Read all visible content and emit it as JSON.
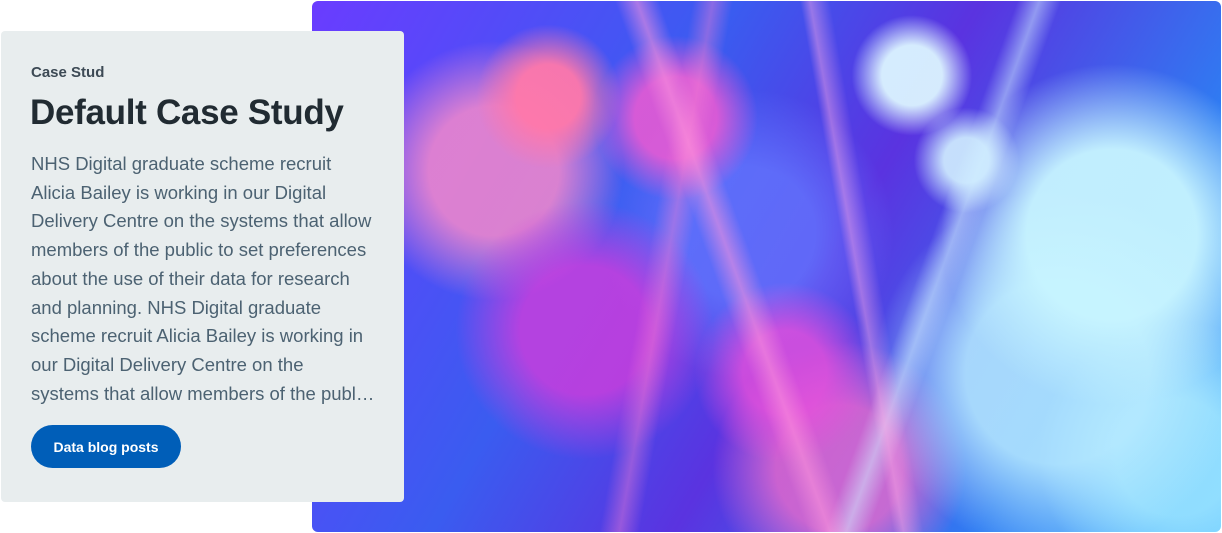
{
  "card": {
    "eyebrow": "Case Stud",
    "title": "Default Case Study",
    "description": "NHS Digital graduate scheme recruit Alicia Bailey is working in our Digital Delivery Centre on the systems that allow members of the public to set preferences about the use of their data for research and planning. NHS Digital graduate scheme recruit Alicia Bailey is working in our Digital Delivery Centre on the systems that allow members of the public to set preferences about the use of their data for research and planning.",
    "button_label": "Data blog posts"
  },
  "colors": {
    "card_background": "#e8edee",
    "button_background": "#005eb8",
    "title_color": "#212b32",
    "text_color": "#4c6272"
  },
  "icons": {
    "hero_image": "fiber-optic-bokeh-image"
  }
}
